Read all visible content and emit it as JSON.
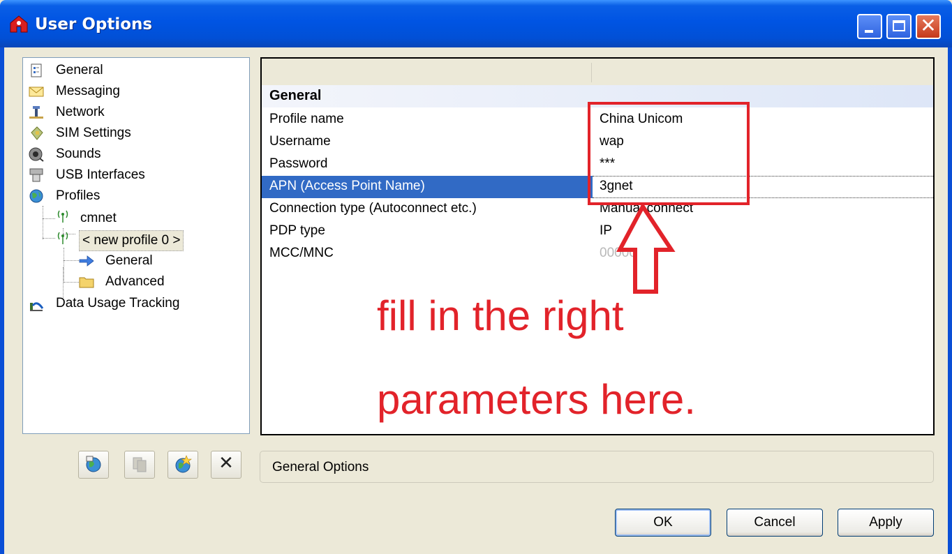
{
  "window": {
    "title": "User Options",
    "minimize_icon": "minimize-icon",
    "maximize_icon": "maximize-icon",
    "close_label": "✕"
  },
  "tree": {
    "items": [
      {
        "label": "General",
        "icon": "document-icon"
      },
      {
        "label": "Messaging",
        "icon": "envelope-icon"
      },
      {
        "label": "Network",
        "icon": "network-icon"
      },
      {
        "label": "SIM Settings",
        "icon": "sim-card-icon"
      },
      {
        "label": "Sounds",
        "icon": "speaker-icon"
      },
      {
        "label": "USB Interfaces",
        "icon": "usb-icon"
      },
      {
        "label": "Profiles",
        "icon": "globe-icon"
      },
      {
        "label": "cmnet",
        "icon": "antenna-icon"
      },
      {
        "label": "< new profile 0 >",
        "icon": "antenna-icon"
      },
      {
        "label": "General",
        "icon": "arrow-right-icon"
      },
      {
        "label": "Advanced",
        "icon": "folder-icon"
      },
      {
        "label": "Data Usage Tracking",
        "icon": "chart-icon"
      }
    ]
  },
  "grid": {
    "category": "General",
    "rows": [
      {
        "name": "Profile name",
        "value": "China Unicom"
      },
      {
        "name": "Username",
        "value": "wap"
      },
      {
        "name": "Password",
        "value": "***"
      },
      {
        "name": "APN (Access Point Name)",
        "value": "3gnet"
      },
      {
        "name": "Connection type (Autoconnect etc.)",
        "value": "Manual connect"
      },
      {
        "name": "PDP type",
        "value": "IP"
      },
      {
        "name": "MCC/MNC",
        "value": "000000"
      }
    ]
  },
  "annotation": {
    "line1": "fill in the right",
    "line2": "parameters here.",
    "color": "#e2232a"
  },
  "toolbar": {
    "buttons": [
      "connect-profile-icon",
      "copy-profile-icon",
      "new-profile-icon",
      "delete-icon"
    ],
    "delete_label": "✕"
  },
  "status": {
    "text": "General Options"
  },
  "buttons": {
    "ok": "OK",
    "cancel": "Cancel",
    "apply": "Apply"
  }
}
